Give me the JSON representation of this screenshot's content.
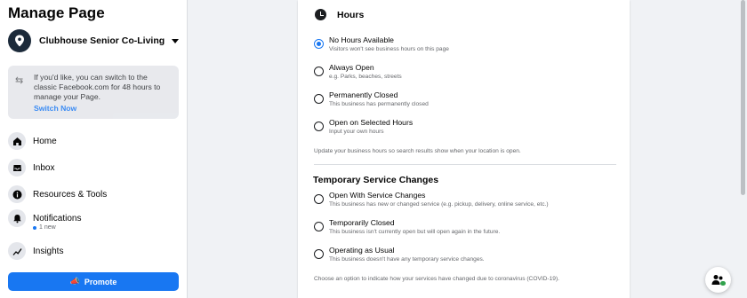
{
  "sidebar": {
    "title": "Manage Page",
    "page_name": "Clubhouse Senior Co-Living",
    "switch_notice": "If you'd like, you can switch to the classic Facebook.com for 48 hours to manage your Page.",
    "switch_link": "Switch Now",
    "nav": [
      {
        "label": "Home",
        "icon": "home-icon"
      },
      {
        "label": "Inbox",
        "icon": "inbox-icon"
      },
      {
        "label": "Resources & Tools",
        "icon": "info-icon"
      },
      {
        "label": "Notifications",
        "icon": "bell-icon",
        "sub": "1 new"
      },
      {
        "label": "Insights",
        "icon": "insights-icon"
      }
    ],
    "promote_label": "Promote"
  },
  "hours": {
    "title": "Hours",
    "options": [
      {
        "label": "No Hours Available",
        "desc": "Visitors won't see business hours on this page",
        "selected": true
      },
      {
        "label": "Always Open",
        "desc": "e.g. Parks, beaches, streets",
        "selected": false
      },
      {
        "label": "Permanently Closed",
        "desc": "This business has permanently closed",
        "selected": false
      },
      {
        "label": "Open on Selected Hours",
        "desc": "Input your own hours",
        "selected": false
      }
    ],
    "note": "Update your business hours so search results show when your location is open."
  },
  "temporary": {
    "title": "Temporary Service Changes",
    "options": [
      {
        "label": "Open With Service Changes",
        "desc": "This business has new or changed service (e.g. pickup, delivery, online service, etc.)",
        "selected": false
      },
      {
        "label": "Temporarily Closed",
        "desc": "This business isn't currently open but will open again in the future.",
        "selected": false
      },
      {
        "label": "Operating as Usual",
        "desc": "This business doesn't have any temporary service changes.",
        "selected": false
      }
    ],
    "note": "Choose an option to indicate how your services have changed due to coronavirus (COVID-19)."
  },
  "colors": {
    "accent": "#1877f2",
    "background": "#f0f2f5",
    "text_secondary": "#65676b"
  }
}
